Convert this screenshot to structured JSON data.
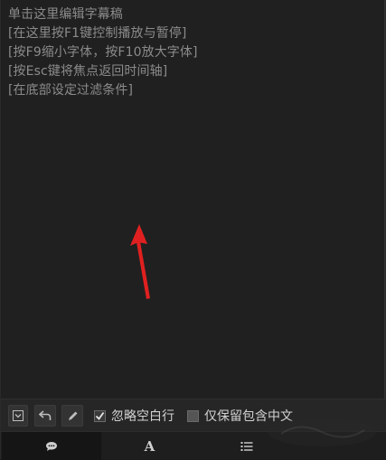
{
  "editor": {
    "lines": [
      "单击这里编辑字幕稿",
      "[在这里按F1键控制播放与暂停]",
      "[按F9缩小字体，按F10放大字体]",
      "[按Esc键将焦点返回时间轴]",
      "[在底部设定过滤条件]"
    ]
  },
  "toolbar": {
    "buttons": [
      {
        "icon": "collapse-icon"
      },
      {
        "icon": "undo-icon"
      },
      {
        "icon": "pencil-icon"
      }
    ],
    "ignore_blank": {
      "label": "忽略空白行",
      "checked": true
    },
    "keep_only": {
      "label": "仅保留包含中文",
      "checked": false
    }
  },
  "tabs": [
    {
      "icon": "chat-bubble-icon",
      "active": true
    },
    {
      "icon": "font-icon",
      "glyph": "A",
      "active": false
    },
    {
      "icon": "list-icon",
      "active": false
    }
  ],
  "colors": {
    "arrow": "#e02020",
    "text": "#8b8b8b",
    "background": "#202020"
  }
}
